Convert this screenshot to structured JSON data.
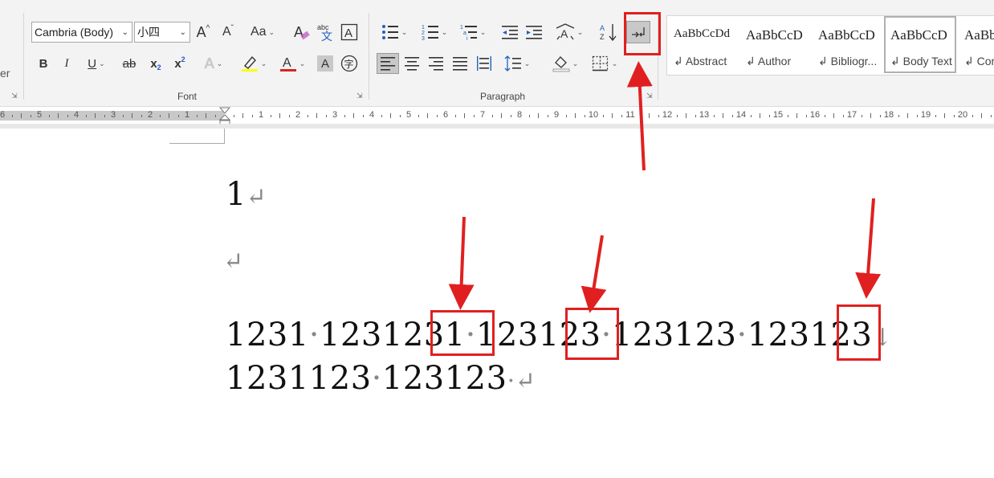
{
  "font": {
    "name_value": "Cambria (Body)",
    "size_value": "小四",
    "group_label": "Font",
    "grow_label": "A",
    "shrink_label": "A",
    "case_label": "Aa",
    "bold": "B",
    "italic": "I",
    "underline": "U",
    "strike": "ab",
    "subscript": "x",
    "subscript_small": "2",
    "superscript": "x",
    "superscript_small": "2",
    "highlight_color": "#ffff00",
    "font_color": "#e02020",
    "phonetic_label": "abc",
    "text_effects": "A",
    "shading": "A",
    "color_letter": "A",
    "enclose": "字"
  },
  "paragraph": {
    "group_label": "Paragraph"
  },
  "left_partial": "er",
  "styles": [
    {
      "sample": "AaBbCcDd",
      "name": "Abstract"
    },
    {
      "sample": "AaBbCcD",
      "name": "Author"
    },
    {
      "sample": "AaBbCcD",
      "name": "Bibliogr..."
    },
    {
      "sample": "AaBbCcD",
      "name": "Body Text",
      "selected": true
    },
    {
      "sample": "AaBb",
      "name": "Com"
    }
  ],
  "ruler": {
    "left_numbers": [
      "6",
      "5",
      "4",
      "3",
      "2",
      "1"
    ],
    "right_numbers": [
      "1",
      "2",
      "3",
      "4",
      "5",
      "6",
      "7",
      "8",
      "9",
      "10",
      "11",
      "12",
      "13",
      "14",
      "15",
      "16",
      "17",
      "18",
      "19",
      "20"
    ]
  },
  "document": {
    "line1": "1",
    "line1_mark": "↵",
    "line2_mark": "↵",
    "line3": [
      {
        "t": "1231",
        "c": "text"
      },
      {
        "t": "·",
        "c": "mark"
      },
      {
        "t": "1231231",
        "c": "text"
      },
      {
        "t": "·",
        "c": "mark"
      },
      {
        "t": "123123",
        "c": "text"
      },
      {
        "t": "·",
        "c": "mark"
      },
      {
        "t": "123123",
        "c": "text"
      },
      {
        "t": "·",
        "c": "mark"
      },
      {
        "t": "123123",
        "c": "text"
      },
      {
        "t": "↓",
        "c": "mark"
      }
    ],
    "line4": [
      {
        "t": "1231123",
        "c": "text"
      },
      {
        "t": "·",
        "c": "mark"
      },
      {
        "t": "123123",
        "c": "text"
      },
      {
        "t": "·↵",
        "c": "mark"
      }
    ]
  },
  "colors": {
    "annotation_red": "#e02020",
    "highlighted_button_bg": "#c8c8c8"
  }
}
